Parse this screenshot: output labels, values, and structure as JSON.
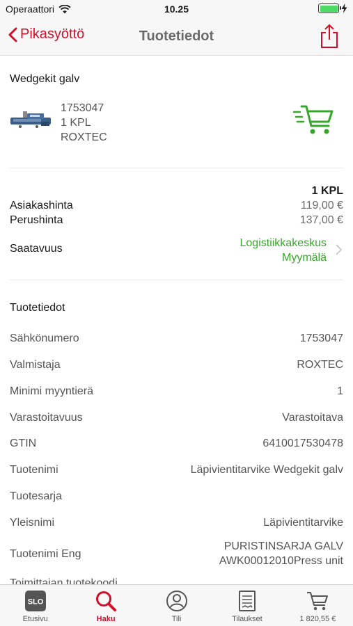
{
  "status_bar": {
    "carrier": "Operaattori",
    "time": "10.25"
  },
  "nav": {
    "back_label": "Pikasyöttö",
    "title": "Tuotetiedot",
    "share_icon": "share-icon"
  },
  "product": {
    "name": "Wedgekit galv",
    "number": "1753047",
    "quantity": "1 KPL",
    "brand": "ROXTEC",
    "cart_icon": "add-to-cart-icon"
  },
  "pricing": {
    "unit": "1 KPL",
    "customer_price_label": "Asiakashinta",
    "customer_price": "119,00 €",
    "base_price_label": "Perushinta",
    "base_price": "137,00 €"
  },
  "availability": {
    "label": "Saatavuus",
    "locations": [
      "Logistiikkakeskus",
      "Myymälä"
    ],
    "color": "#35a82a"
  },
  "details": {
    "title": "Tuotetiedot",
    "rows": [
      {
        "label": "Sähkönumero",
        "value": "1753047"
      },
      {
        "label": "Valmistaja",
        "value": "ROXTEC"
      },
      {
        "label": "Minimi myyntierä",
        "value": "1"
      },
      {
        "label": "Varastoitavuus",
        "value": "Varastoitava"
      },
      {
        "label": "GTIN",
        "value": "6410017530478"
      },
      {
        "label": "Tuotenimi",
        "value": "Läpivientitarvike Wedgekit galv"
      },
      {
        "label": "Tuotesarja",
        "value": ""
      },
      {
        "label": "Yleisnimi",
        "value": "Läpivientitarvike"
      },
      {
        "label": "Tuotenimi Eng",
        "value": "PURISTINSARJA GALV",
        "value2": "AWK00012010Press unit"
      },
      {
        "label": "Toimittajan tuotekoodi",
        "value": ""
      }
    ]
  },
  "tabs": [
    {
      "label": "Etusivu",
      "icon": "slo-logo-icon"
    },
    {
      "label": "Haku",
      "icon": "search-icon",
      "active": true
    },
    {
      "label": "Tili",
      "icon": "account-icon"
    },
    {
      "label": "Tilaukset",
      "icon": "orders-icon"
    },
    {
      "label": "1 820,55 €",
      "icon": "cart-icon"
    }
  ],
  "colors": {
    "accent": "#d0102b",
    "availability": "#35a82a",
    "cart": "#35a82a"
  }
}
